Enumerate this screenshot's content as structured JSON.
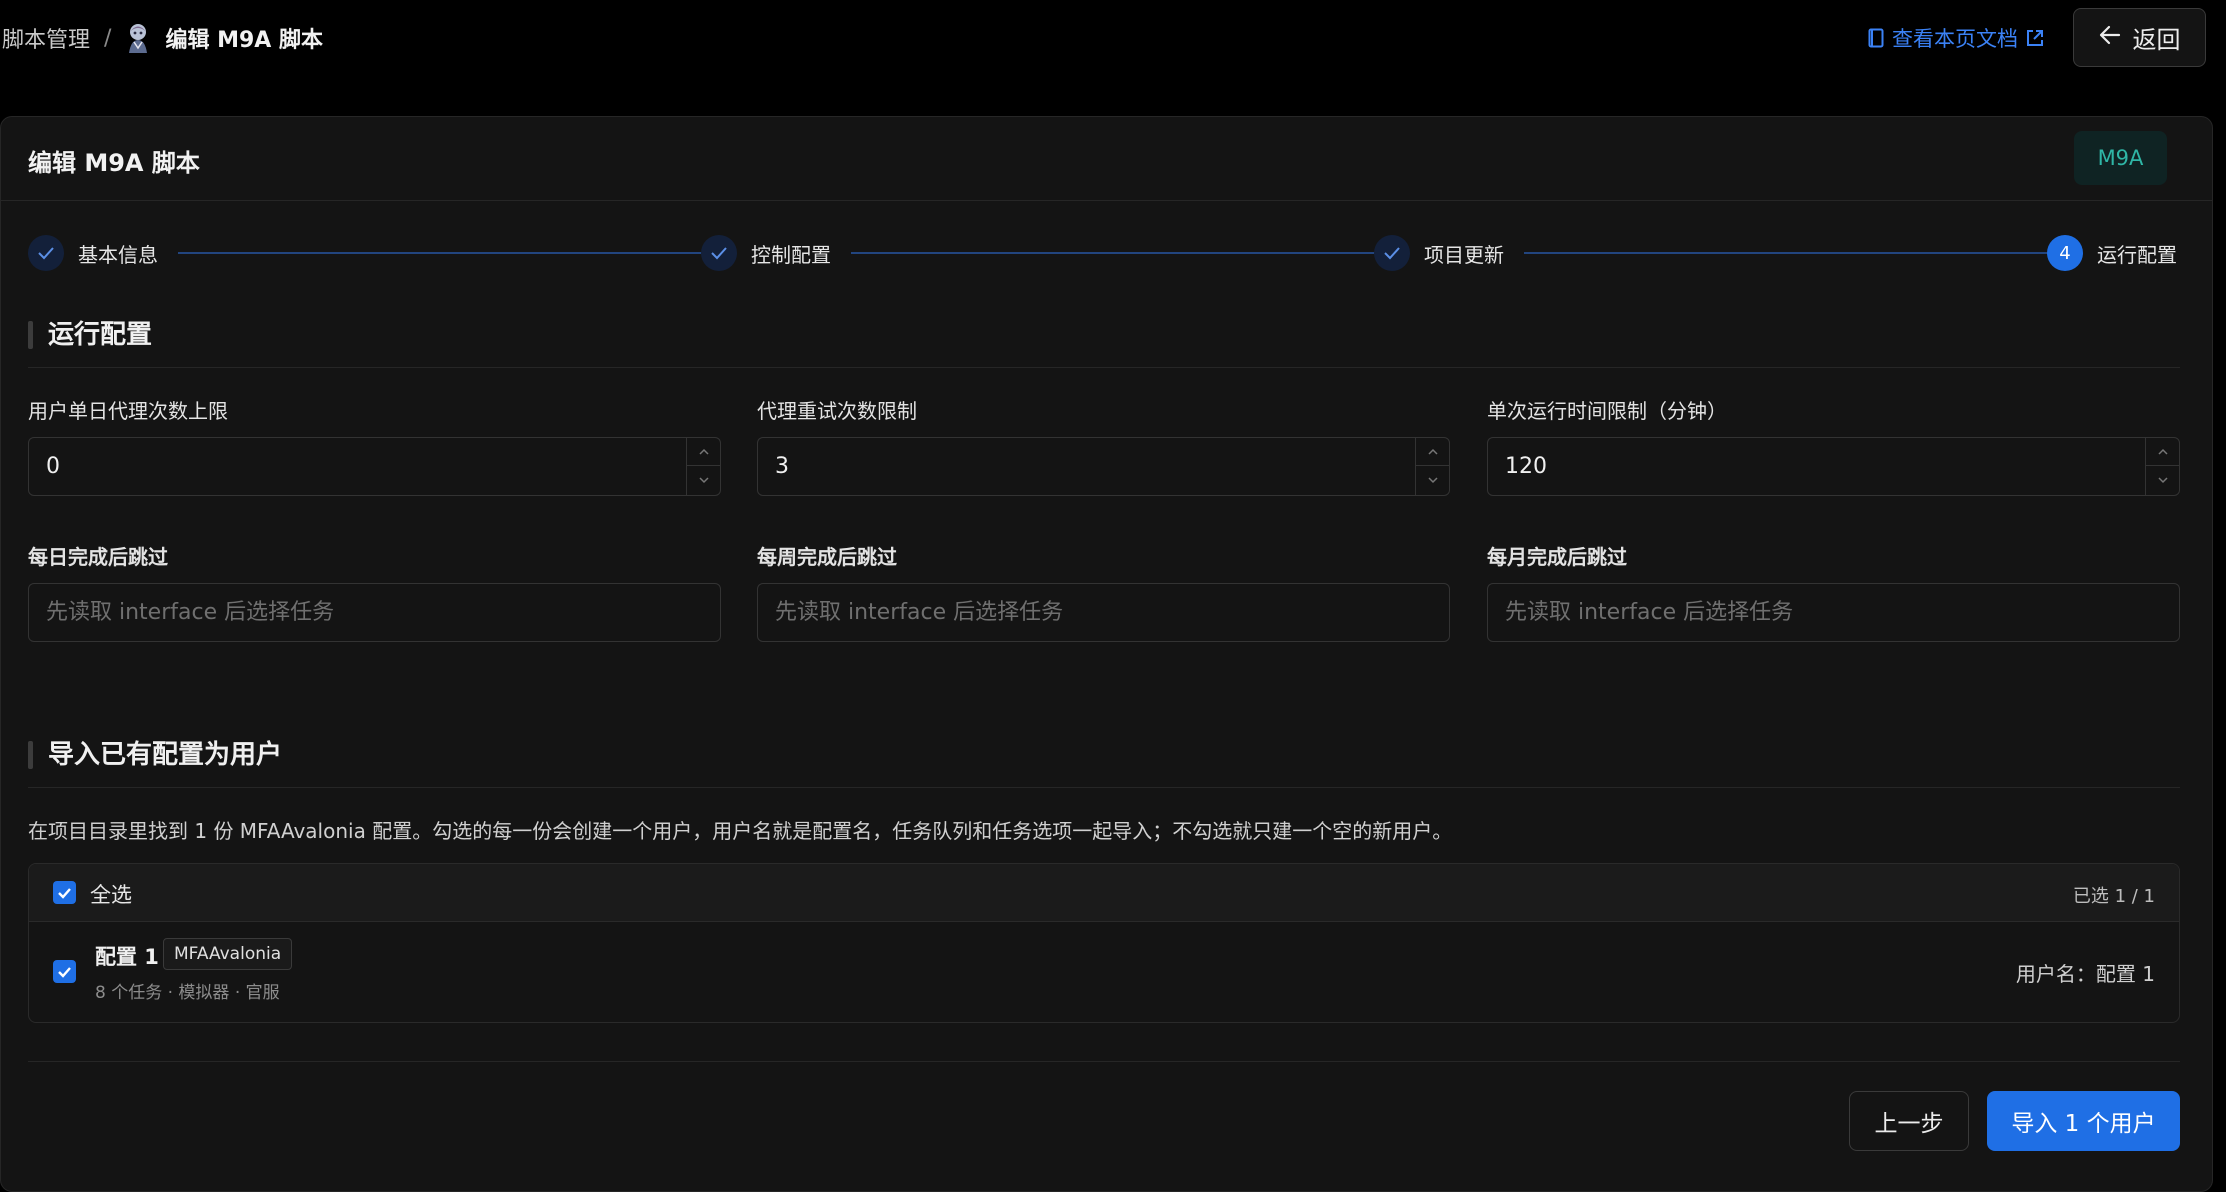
{
  "colors": {
    "accent": "#1f6fe5",
    "link": "#3b82f6",
    "tag_text": "#2fb6a6",
    "background": "#000000",
    "card": "#141414"
  },
  "breadcrumb": {
    "parent": "脚本管理",
    "separator": "/",
    "current": "编辑 M9A 脚本"
  },
  "header": {
    "doc_link": "查看本页文档",
    "back_label": "返回"
  },
  "card": {
    "title": "编辑 M9A 脚本",
    "script_tag": "M9A"
  },
  "steps": [
    {
      "label": "基本信息",
      "state": "done"
    },
    {
      "label": "控制配置",
      "state": "done"
    },
    {
      "label": "项目更新",
      "state": "done"
    },
    {
      "label": "运行配置",
      "state": "active",
      "number": "4"
    }
  ],
  "run_config": {
    "section_title": "运行配置",
    "daily_limit": {
      "label": "用户单日代理次数上限",
      "value": "0"
    },
    "retry_limit": {
      "label": "代理重试次数限制",
      "value": "3"
    },
    "time_limit": {
      "label": "单次运行时间限制（分钟）",
      "value": "120"
    },
    "skip_daily": {
      "label": "每日完成后跳过",
      "placeholder": "先读取 interface 后选择任务"
    },
    "skip_weekly": {
      "label": "每周完成后跳过",
      "placeholder": "先读取 interface 后选择任务"
    },
    "skip_monthly": {
      "label": "每月完成后跳过",
      "placeholder": "先读取 interface 后选择任务"
    }
  },
  "import": {
    "section_title": "导入已有配置为用户",
    "description": "在项目目录里找到 1 份 MFAAvalonia 配置。勾选的每一份会创建一个用户，用户名就是配置名，任务队列和任务选项一起导入；不勾选就只建一个空的新用户。",
    "select_all_label": "全选",
    "select_all_checked": true,
    "selected_count": "已选 1 / 1",
    "configs": [
      {
        "name": "配置 1",
        "badge": "MFAAvalonia",
        "meta": "8 个任务 · 模拟器 · 官服",
        "username": "用户名：配置 1",
        "checked": true
      }
    ]
  },
  "footer": {
    "prev_label": "上一步",
    "import_label": "导入 1 个用户"
  },
  "icons": {
    "avatar": "character-avatar-icon",
    "doc": "document-icon",
    "external": "external-link-icon",
    "back": "arrow-left-icon",
    "step_done": "check-icon",
    "spin_up": "chevron-up-icon",
    "spin_down": "chevron-down-icon",
    "checkbox": "checkbox-checked-icon"
  }
}
